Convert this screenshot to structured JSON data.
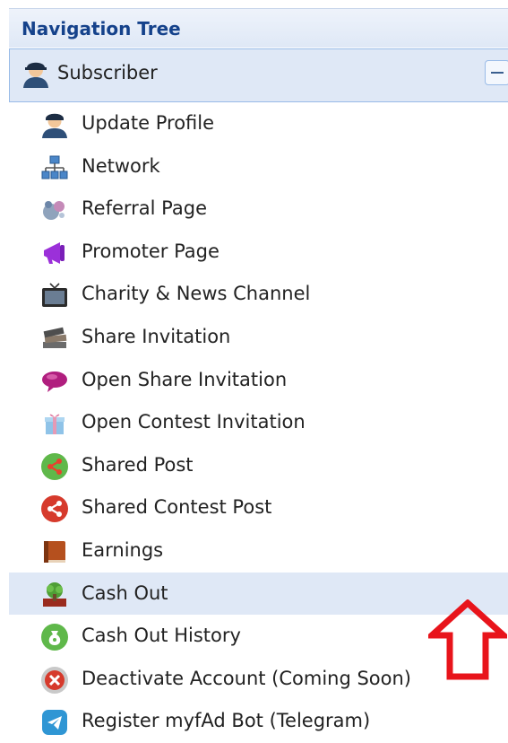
{
  "panel": {
    "title": "Navigation Tree"
  },
  "root_node": {
    "label": "Subscriber",
    "icon": "user-avatar-icon",
    "collapse_symbol": "−"
  },
  "items": [
    {
      "label": "Update Profile",
      "icon": "user-avatar-icon"
    },
    {
      "label": "Network",
      "icon": "network-icon"
    },
    {
      "label": "Referral Page",
      "icon": "referral-icon"
    },
    {
      "label": "Promoter Page",
      "icon": "megaphone-icon"
    },
    {
      "label": "Charity & News Channel",
      "icon": "tv-icon"
    },
    {
      "label": "Share Invitation",
      "icon": "books-icon"
    },
    {
      "label": "Open Share Invitation",
      "icon": "speech-bubble-icon"
    },
    {
      "label": "Open Contest Invitation",
      "icon": "gift-icon"
    },
    {
      "label": "Shared Post",
      "icon": "share-green-icon"
    },
    {
      "label": "Shared Contest Post",
      "icon": "share-red-icon"
    },
    {
      "label": "Earnings",
      "icon": "book-icon"
    },
    {
      "label": "Cash Out",
      "icon": "money-tree-icon",
      "selected": true
    },
    {
      "label": "Cash Out History",
      "icon": "money-bag-icon"
    },
    {
      "label": "Deactivate Account (Coming Soon)",
      "icon": "cancel-icon"
    },
    {
      "label": "Register myfAd Bot (Telegram)",
      "icon": "telegram-icon"
    }
  ],
  "annotation": {
    "arrow_color": "#e8141b"
  }
}
